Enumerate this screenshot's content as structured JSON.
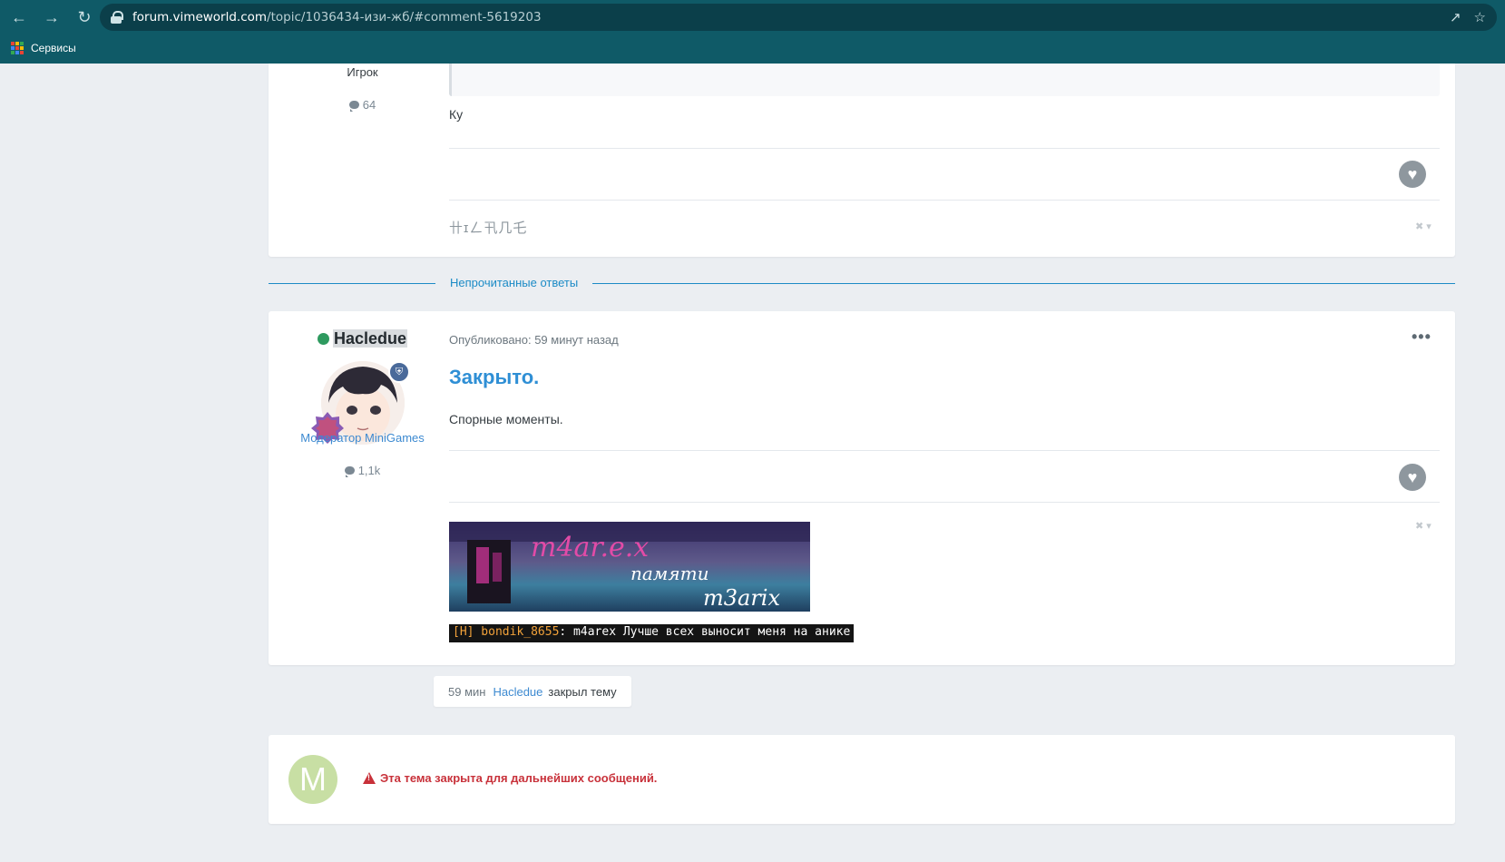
{
  "browser": {
    "url_host": "forum.vimeworld.com",
    "url_path": "/topic/1036434-изи-жб/#comment-5619203",
    "bookmarks_label": "Сервисы",
    "icons": [
      "back-arrow-icon",
      "forward-arrow-icon",
      "reload-icon",
      "lock-icon",
      "share-icon",
      "star-icon",
      "apps-grid-icon"
    ]
  },
  "post1": {
    "rank": "Игрок",
    "post_count": "64",
    "text": "Ку",
    "signature": "卄ɪㄥ卂几乇"
  },
  "divider": {
    "label": "Непрочитанные ответы"
  },
  "post2": {
    "author": "Hacledue",
    "group": "Модератор MiniGames",
    "post_count": "1,1k",
    "posted": "Опубликовано: 59 минут назад",
    "title": "Закрыто.",
    "text": "Спорные моменты.",
    "signature_banner": {
      "line1": "m4ar.e.x",
      "line2": "памяти",
      "line3": "m3arix"
    },
    "chat_tag": "[H] bondik_8655",
    "chat_text": ": m4arex Лучше всех выносит меня на анике",
    "more_label": "•••"
  },
  "event": {
    "ago": "59 мин",
    "who": "Hacledue",
    "action": "закрыл тему"
  },
  "closed_notice": {
    "avatar_letter": "M",
    "message": "Эта тема закрыта для дальнейших сообщений."
  },
  "colors": {
    "chrome": "#0f5a67",
    "link": "#3d8ad1",
    "title": "#2f8fd5",
    "divider": "#1c8bc6",
    "online": "#2e9a5f",
    "error": "#c8313a"
  }
}
